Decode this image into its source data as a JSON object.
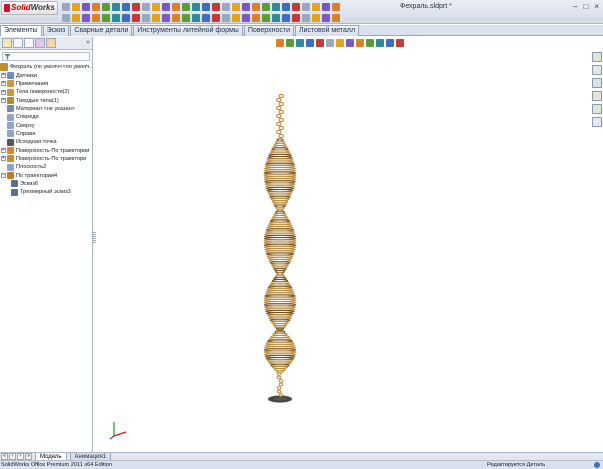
{
  "app": {
    "logo_text_a": "Solid",
    "logo_text_b": "Works",
    "document_title": "Фехраль.sldprt *",
    "window_controls": [
      "–",
      "□",
      "×"
    ]
  },
  "command_tabs": [
    {
      "label": "Элементы",
      "active": true
    },
    {
      "label": "Эскиз",
      "active": false
    },
    {
      "label": "Сварные детали",
      "active": false
    },
    {
      "label": "Инструменты литейной формы",
      "active": false
    },
    {
      "label": "Поверхности",
      "active": false
    },
    {
      "label": "Листовой металл",
      "active": false
    }
  ],
  "feature_tree": {
    "root_label": "Фехраль  (по умолч<<по умолч...",
    "items": [
      {
        "label": "Датчики",
        "icon": "sensor-icon",
        "color": "#6b8fc7",
        "expander": "+",
        "indent": 1
      },
      {
        "label": "Примечания",
        "icon": "annotation-icon",
        "color": "#c79a3a",
        "expander": "+",
        "indent": 1
      },
      {
        "label": "Тела поверхности(2)",
        "icon": "surface-bodies-icon",
        "color": "#c79a3a",
        "expander": "+",
        "indent": 1
      },
      {
        "label": "Твердые тела(1)",
        "icon": "solid-bodies-icon",
        "color": "#b58a2e",
        "expander": "+",
        "indent": 1
      },
      {
        "label": "Материал <не указан>",
        "icon": "material-icon",
        "color": "#7a8aa3",
        "expander": "",
        "indent": 1
      },
      {
        "label": "Спереди",
        "icon": "plane-icon",
        "color": "#8fa4c6",
        "expander": "",
        "indent": 1
      },
      {
        "label": "Сверху",
        "icon": "plane-icon",
        "color": "#8fa4c6",
        "expander": "",
        "indent": 1
      },
      {
        "label": "Справа",
        "icon": "plane-icon",
        "color": "#8fa4c6",
        "expander": "",
        "indent": 1
      },
      {
        "label": "Исходная точка",
        "icon": "origin-icon",
        "color": "#555555",
        "expander": "",
        "indent": 1
      },
      {
        "label": "Поверхность-По траектории",
        "icon": "sweep-surface-icon",
        "color": "#d08a2a",
        "expander": "+",
        "indent": 1
      },
      {
        "label": "Поверхность-По траектори",
        "icon": "sweep-surface-icon",
        "color": "#d08a2a",
        "expander": "+",
        "indent": 1
      },
      {
        "label": "Плоскость2",
        "icon": "plane-icon",
        "color": "#8fa4c6",
        "expander": "",
        "indent": 1
      },
      {
        "label": "По траектории4",
        "icon": "sweep-icon",
        "color": "#c27a25",
        "expander": "–",
        "indent": 1
      },
      {
        "label": "Эскиз6",
        "icon": "sketch-icon",
        "color": "#5b6f8f",
        "expander": "",
        "indent": 2
      },
      {
        "label": "Трехмерный эскиз3",
        "icon": "3d-sketch-icon",
        "color": "#5b6f8f",
        "expander": "",
        "indent": 2
      }
    ]
  },
  "bottom_tabs": [
    {
      "label": "Модель",
      "active": true
    },
    {
      "label": "Анимация1",
      "active": false
    }
  ],
  "status": {
    "left_text": "SolidWorks Office Premium 2011 x64 Edition",
    "right_text": "Редактируется Деталь"
  },
  "colors": {
    "accent": "#c8102e",
    "model_wire": "#b98a3c",
    "model_wire_dark": "#6e4e1c",
    "chrome": "#d9e1ec"
  }
}
